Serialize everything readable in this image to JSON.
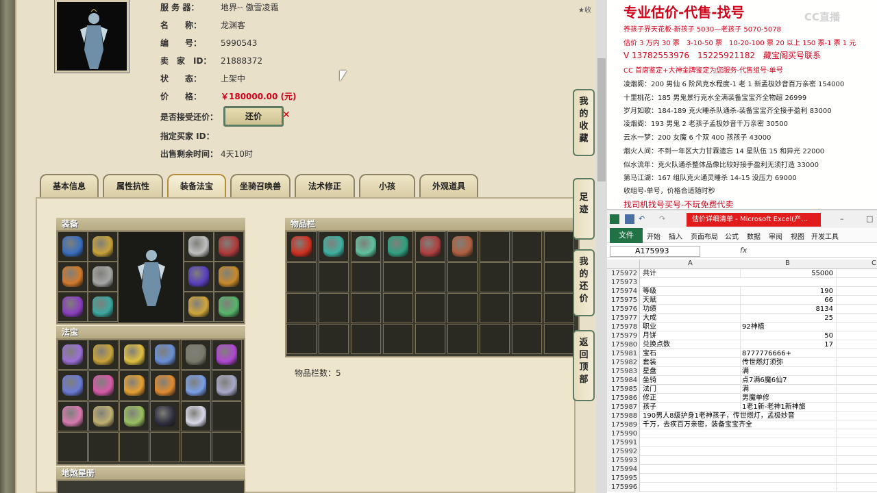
{
  "game": {
    "fav_link": "收",
    "info": [
      {
        "label": "服 务 器：",
        "value": "地界-- 傲雪凌霜"
      },
      {
        "label": "名　　称：",
        "value": "龙渊客"
      },
      {
        "label": "编　　号：",
        "value": "5990543"
      },
      {
        "label": "卖　家　ID：",
        "value": "21888372"
      },
      {
        "label": "状　　态：",
        "value": "上架中"
      },
      {
        "label": "价　　格：",
        "value": "￥180000.00 (元)"
      },
      {
        "label": "是否接受还价：",
        "value": ""
      },
      {
        "label": "指定买家 ID：",
        "value": ""
      },
      {
        "label": "出售剩余时间：",
        "value": "4天10时"
      }
    ],
    "haggle_label": "还价",
    "tabs": [
      "基本信息",
      "属性抗性",
      "装备法宝",
      "坐骑召唤兽",
      "法术修正",
      "小孩",
      "外观道具"
    ],
    "active_tab": "装备法宝",
    "equip_title": "装备",
    "treasure_title": "法宝",
    "star_title": "地煞星册",
    "inventory_title": "物品栏",
    "inventory_count": "物品栏数：5",
    "side_buttons": [
      "我的收藏",
      "足迹",
      "我的还价",
      "返回顶部"
    ],
    "equip_colors": [
      "#3a6fbf",
      "#c9a33a",
      "#d27a2b",
      "#a6a6a6",
      "#8a3fbf",
      "#3aa8a0",
      "#bfbfbf",
      "#b03a3a",
      "#5a3fbf",
      "#c98a2b",
      "#d1a53a",
      "#56b56a"
    ],
    "treasure_colors": [
      "#9b6fd6",
      "#c9a33a",
      "#e0c040",
      "#6a8fd6",
      "#7a7a6a",
      "#b048d0",
      "#6a7ad6",
      "#d65aa8",
      "#e6a030",
      "#e08a30",
      "#7aa0e6",
      "#a8a8c8",
      "#d87ab0",
      "#c0b070",
      "#9ac060",
      "#303040",
      "#d8d8e8"
    ],
    "inventory_colors": [
      "#d03020",
      "#40b0a0",
      "#60c0a0",
      "#30a080",
      "#b04040",
      "#b06040"
    ]
  },
  "notes": {
    "watermark": "CC直播",
    "title": "专业估价-代售-找号",
    "lines": [
      {
        "text": "养孩子界天花板-新孩子 5030—老孩子 5070-5078",
        "red": true
      },
      {
        "text": "估价 3 万内 30 票　3-10-50 票　10-20-100 票 20 以上 150 票-1 票 1 元",
        "red": true
      },
      {
        "text": "V 13782553976　15225921182　藏宝阁买号联系",
        "red": true,
        "big": true
      },
      {
        "text": "CC 首席鉴定+大神金牌鉴定为您服务-代售组号-单号",
        "red": true
      },
      {
        "text": "凌烟阁：200 男仙 6 阶风克水程度-1 老 1 新孟极妙音百万亲密 154000",
        "red": false
      },
      {
        "text": "十里桃花：185 男鬼景行克水全满装备宝宝齐全物超 26999",
        "red": false
      },
      {
        "text": "岁月如歌：184-189 克火睡杀队通杀-装备宝宝齐全接手盈利 83000",
        "red": false
      },
      {
        "text": "凌烟阁：193 男鬼 2 老孩子孟极妙音千万亲密 30500",
        "red": false
      },
      {
        "text": "云水一梦：200 女魔 6 个双 400 孩孩子 43000",
        "red": false
      },
      {
        "text": "烟火人间：不到一年区大力甘霖遗忘 14 星队伍 15 和异光 22000",
        "red": false
      },
      {
        "text": "似水流年：克火队通杀整体品像比较好接手盈利无须打造 33000",
        "red": false
      },
      {
        "text": "第马江湖：167 组队克火通灵睡杀 14-15 没压力 69000",
        "red": false
      },
      {
        "text": "收组号-单号，价格合适随时秒",
        "red": false
      },
      {
        "text": "找司机找号买号-不玩免费代卖",
        "red": true,
        "big": true
      }
    ]
  },
  "excel": {
    "title": "估价详细清单 - Microsoft Excel(产...",
    "file_tab": "文件",
    "menus": [
      "开始",
      "插入",
      "页面布局",
      "公式",
      "数据",
      "审阅",
      "视图",
      "开发工具"
    ],
    "namebox": "A175993",
    "fx": "fx",
    "columns": [
      "A",
      "B",
      "C"
    ],
    "rows": [
      {
        "n": "175972",
        "a": "共计",
        "b": "55000",
        "num": true
      },
      {
        "n": "175973",
        "a": "",
        "b": "",
        "num": true
      },
      {
        "n": "175974",
        "a": "等级",
        "b": "190",
        "num": true
      },
      {
        "n": "175975",
        "a": "天赋",
        "b": "66",
        "num": true
      },
      {
        "n": "175976",
        "a": "功绩",
        "b": "8134",
        "num": true
      },
      {
        "n": "175977",
        "a": "大成",
        "b": "25",
        "num": true
      },
      {
        "n": "175978",
        "a": "职业",
        "b": "92神植",
        "num": false
      },
      {
        "n": "175979",
        "a": "月饼",
        "b": "50",
        "num": true
      },
      {
        "n": "175980",
        "a": "兑换点数",
        "b": "17",
        "num": true
      },
      {
        "n": "175981",
        "a": "宝石",
        "b": "8777776666+",
        "num": false
      },
      {
        "n": "175982",
        "a": "套装",
        "b": "传世燃灯须弥",
        "num": false
      },
      {
        "n": "175983",
        "a": "星盘",
        "b": "满",
        "num": false
      },
      {
        "n": "175984",
        "a": "坐骑",
        "b": "点7满6魔6仙7",
        "num": false
      },
      {
        "n": "175985",
        "a": "法门",
        "b": "满",
        "num": false
      },
      {
        "n": "175986",
        "a": "修正",
        "b": "男魔单修",
        "num": false
      },
      {
        "n": "175987",
        "a": "孩子",
        "b": "1老1新-老神1新神旅",
        "num": false
      },
      {
        "n": "175988",
        "a": "190男人8级护身1老神孩子，传世燃灯，孟极妙音",
        "b": "",
        "num": false
      },
      {
        "n": "175989",
        "a": "千万，去疾百万亲密，装备宝宝齐全",
        "b": "",
        "num": false
      },
      {
        "n": "175990",
        "a": "",
        "b": "",
        "num": false
      },
      {
        "n": "175991",
        "a": "",
        "b": "",
        "num": false
      },
      {
        "n": "175992",
        "a": "",
        "b": "",
        "num": false
      },
      {
        "n": "175993",
        "a": "",
        "b": "",
        "num": false
      },
      {
        "n": "175994",
        "a": "",
        "b": "",
        "num": false
      },
      {
        "n": "175995",
        "a": "",
        "b": "",
        "num": false
      },
      {
        "n": "175996",
        "a": "",
        "b": "",
        "num": false
      }
    ]
  }
}
